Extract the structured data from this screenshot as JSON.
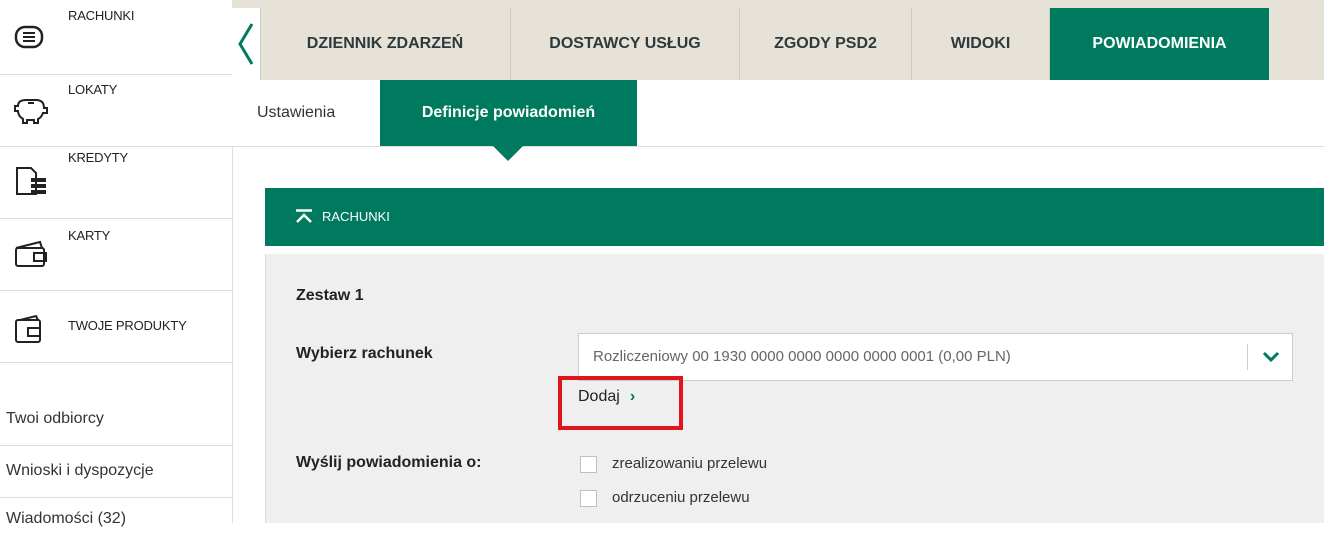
{
  "sidebar": {
    "products": [
      {
        "label": "RACHUNKI",
        "icon": "list-icon"
      },
      {
        "label": "LOKATY",
        "icon": "piggy-bank-icon"
      },
      {
        "label": "KREDYTY",
        "icon": "coins-document-icon"
      },
      {
        "label": "KARTY",
        "icon": "card-wallet-icon"
      },
      {
        "label": "TWOJE PRODUKTY",
        "icon": "wallet-icon"
      }
    ],
    "links": [
      {
        "label": "Twoi odbiorcy"
      },
      {
        "label": "Wnioski i dyspozycje"
      },
      {
        "label": "Wiadomości (32)"
      }
    ]
  },
  "topnav": {
    "tabs": [
      {
        "label": "DZIENNIK ZDARZEŃ"
      },
      {
        "label": "DOSTAWCY USŁUG"
      },
      {
        "label": "ZGODY PSD2"
      },
      {
        "label": "WIDOKI"
      },
      {
        "label": "POWIADOMIENIA"
      }
    ],
    "active_tab": "POWIADOMIENIA"
  },
  "subtabs": [
    {
      "label": "Ustawienia"
    },
    {
      "label": "Definicje powiadomień"
    }
  ],
  "section": {
    "title": "RACHUNKI",
    "set_label": "Zestaw 1",
    "account_label": "Wybierz rachunek",
    "account_value": "Rozliczeniowy 00 1930 0000 0000 0000 0000 0001 (0,00 PLN)",
    "add_label": "Dodaj",
    "send_label": "Wyślij powiadomienia o:",
    "options": [
      {
        "label": "zrealizowaniu przelewu",
        "checked": false
      },
      {
        "label": "odrzuceniu przelewu",
        "checked": false
      }
    ]
  },
  "colors": {
    "accent": "#007a5e",
    "highlight": "#e0151b",
    "nav_bg": "#e6e2d8"
  }
}
